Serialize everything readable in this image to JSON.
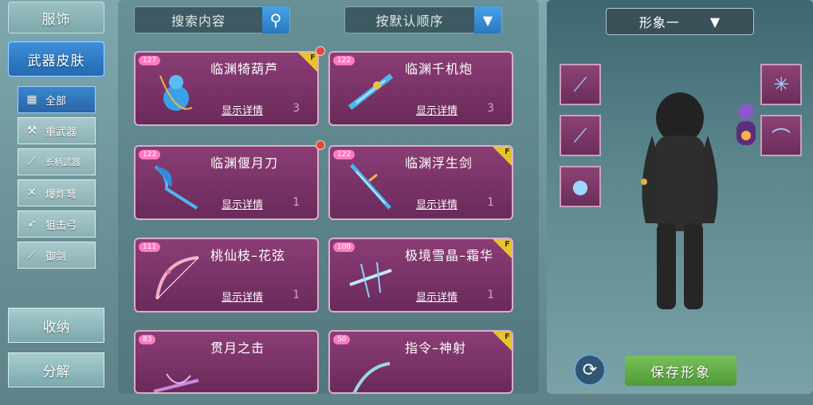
{
  "left_nav": {
    "main_tabs": [
      {
        "label": "服饰"
      },
      {
        "label": "武器皮肤"
      }
    ],
    "sub_tabs": [
      {
        "label": "全部",
        "icon": "grid-icon"
      },
      {
        "label": "重武器",
        "icon": "heavy-weapon-icon"
      },
      {
        "label": "长柄武器",
        "icon": "polearm-icon"
      },
      {
        "label": "爆炸弩",
        "icon": "crossbow-icon"
      },
      {
        "label": "狙击弓",
        "icon": "bow-icon"
      },
      {
        "label": "御剑",
        "icon": "sword-icon"
      }
    ],
    "storage_label": "收纳",
    "dismantle_label": "分解"
  },
  "search": {
    "placeholder": "搜索内容"
  },
  "sort": {
    "label": "按默认顺序"
  },
  "items": [
    {
      "name": "临渊犄葫芦",
      "detail": "显示详情",
      "count": "3",
      "level": "127",
      "flag": "F"
    },
    {
      "name": "临渊千机炮",
      "detail": "显示详情",
      "count": "3",
      "level": "122",
      "flag": ""
    },
    {
      "name": "临渊偃月刀",
      "detail": "显示详情",
      "count": "1",
      "level": "122",
      "flag": ""
    },
    {
      "name": "临渊浮生剑",
      "detail": "显示详情",
      "count": "1",
      "level": "122",
      "flag": "F"
    },
    {
      "name": "桃仙枝–花弦",
      "detail": "显示详情",
      "count": "1",
      "level": "111",
      "flag": ""
    },
    {
      "name": "极境雪晶–霜华",
      "detail": "显示详情",
      "count": "1",
      "level": "100",
      "flag": "F"
    },
    {
      "name": "贯月之击",
      "detail": "",
      "count": "",
      "level": "83",
      "flag": ""
    },
    {
      "name": "指令–神射",
      "detail": "",
      "count": "",
      "level": "50",
      "flag": "F"
    }
  ],
  "preview": {
    "look_label": "形象一",
    "save_label": "保存形象"
  }
}
